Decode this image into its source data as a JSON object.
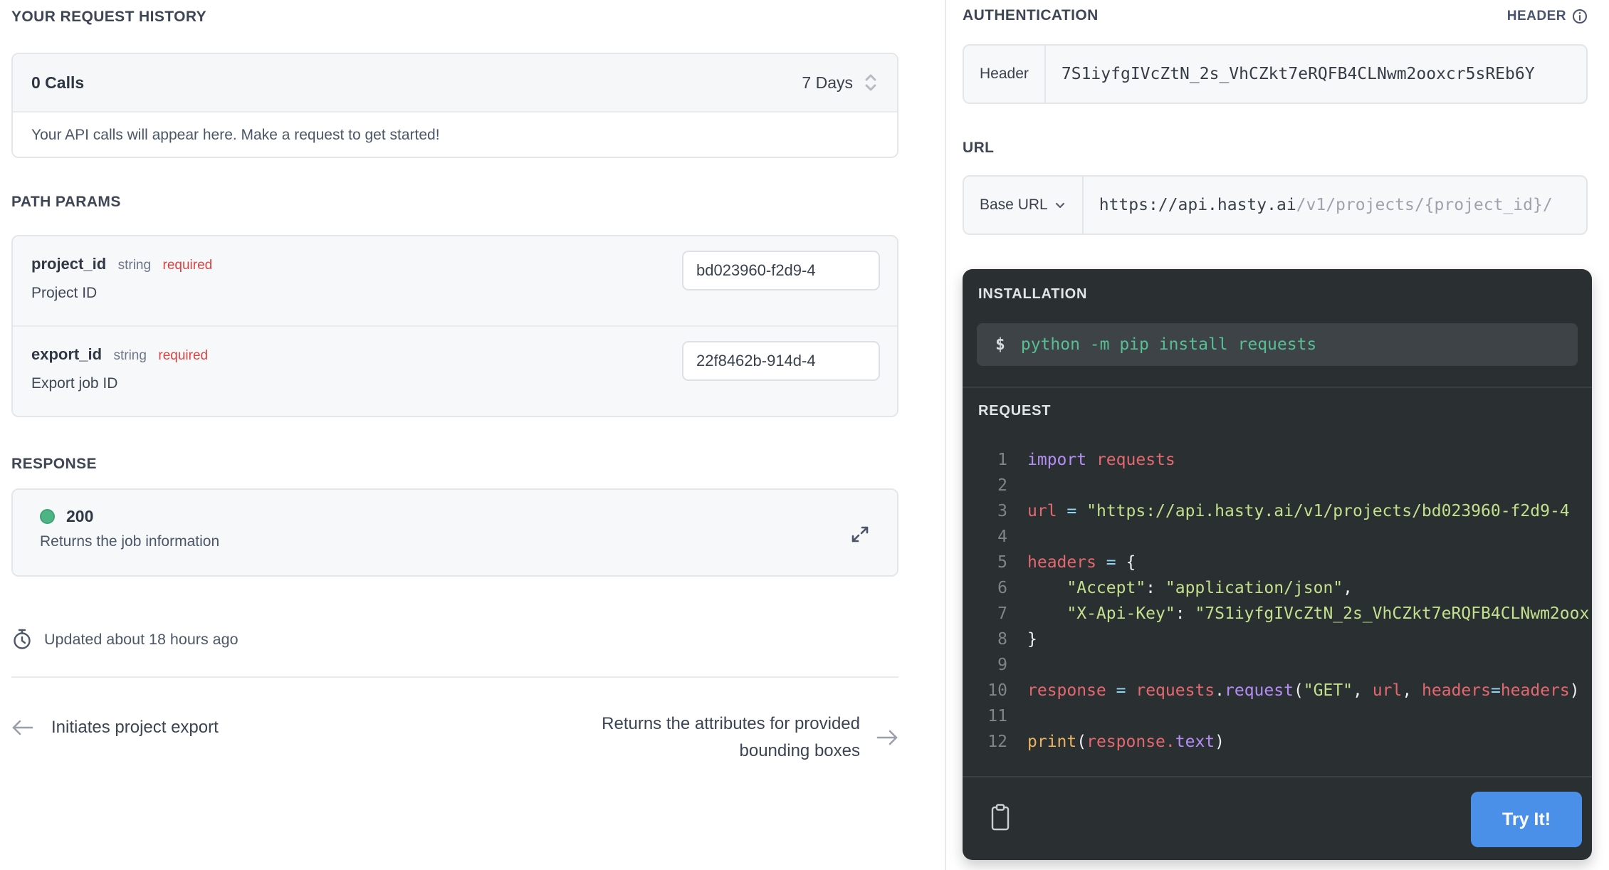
{
  "colors": {
    "accent_blue": "#4a90e8",
    "status_green": "#4db585",
    "required_red": "#db4343",
    "command_green": "#57bf92"
  },
  "request_history": {
    "title": "YOUR REQUEST HISTORY",
    "calls_count": "0 Calls",
    "period": "7 Days",
    "empty_message": "Your API calls will appear here. Make a request to get started!"
  },
  "path_params": {
    "title": "PATH PARAMS",
    "params": [
      {
        "name": "project_id",
        "type": "string",
        "required": "required",
        "description": "Project ID",
        "value": "bd023960-f2d9-4"
      },
      {
        "name": "export_id",
        "type": "string",
        "required": "required",
        "description": "Export job ID",
        "value": "22f8462b-914d-4"
      }
    ]
  },
  "response": {
    "title": "RESPONSE",
    "status_code": "200",
    "description": "Returns the job information"
  },
  "updated_text": "Updated about 18 hours ago",
  "footer_nav": {
    "prev_label": "Initiates project export",
    "next_label": "Returns the attributes for provided bounding boxes"
  },
  "auth": {
    "title": "AUTHENTICATION",
    "type_label": "HEADER",
    "field_label": "Header",
    "value": "7S1iyfgIVcZtN_2s_VhCZkt7eRQFB4CLNwm2ooxcr5sREb6Y"
  },
  "url": {
    "title": "URL",
    "base_label": "Base URL",
    "base": "https://api.hasty.ai",
    "path": "/v1/projects/{project_id}/"
  },
  "code_panel": {
    "installation_title": "INSTALLATION",
    "install_prompt": "$",
    "install_command": "python -m pip install requests",
    "request_title": "REQUEST",
    "try_it_label": "Try It!",
    "request_code": [
      {
        "n": "1",
        "tk": [
          [
            "kw",
            "import"
          ],
          [
            "pl",
            " "
          ],
          [
            "id",
            "requests"
          ]
        ]
      },
      {
        "n": "2",
        "tk": []
      },
      {
        "n": "3",
        "tk": [
          [
            "id",
            "url"
          ],
          [
            "pl",
            " "
          ],
          [
            "op",
            "="
          ],
          [
            "pl",
            " "
          ],
          [
            "str",
            "\"https://api.hasty.ai/v1/projects/bd023960-f2d9-4"
          ]
        ]
      },
      {
        "n": "4",
        "tk": []
      },
      {
        "n": "5",
        "tk": [
          [
            "id",
            "headers"
          ],
          [
            "pl",
            " "
          ],
          [
            "op",
            "="
          ],
          [
            "pl",
            " "
          ],
          [
            "pu",
            "{"
          ]
        ]
      },
      {
        "n": "6",
        "tk": [
          [
            "pl",
            "    "
          ],
          [
            "str",
            "\"Accept\""
          ],
          [
            "pu",
            ":"
          ],
          [
            "pl",
            " "
          ],
          [
            "str",
            "\"application/json\""
          ],
          [
            "pu",
            ","
          ]
        ]
      },
      {
        "n": "7",
        "tk": [
          [
            "pl",
            "    "
          ],
          [
            "str",
            "\"X-Api-Key\""
          ],
          [
            "pu",
            ":"
          ],
          [
            "pl",
            " "
          ],
          [
            "str",
            "\"7S1iyfgIVcZtN_2s_VhCZkt7eRQFB4CLNwm2oox"
          ]
        ]
      },
      {
        "n": "8",
        "tk": [
          [
            "pu",
            "}"
          ]
        ]
      },
      {
        "n": "9",
        "tk": []
      },
      {
        "n": "10",
        "tk": [
          [
            "id",
            "response"
          ],
          [
            "pl",
            " "
          ],
          [
            "op",
            "="
          ],
          [
            "pl",
            " "
          ],
          [
            "id",
            "requests"
          ],
          [
            "pu",
            "."
          ],
          [
            "fn",
            "request"
          ],
          [
            "pu",
            "("
          ],
          [
            "str",
            "\"GET\""
          ],
          [
            "pu",
            ","
          ],
          [
            "pl",
            " "
          ],
          [
            "id",
            "url"
          ],
          [
            "pu",
            ","
          ],
          [
            "pl",
            " "
          ],
          [
            "id",
            "headers"
          ],
          [
            "op",
            "="
          ],
          [
            "id",
            "headers"
          ],
          [
            "pu",
            ")"
          ]
        ]
      },
      {
        "n": "11",
        "tk": []
      },
      {
        "n": "12",
        "tk": [
          [
            "bi",
            "print"
          ],
          [
            "pu",
            "("
          ],
          [
            "id",
            "response"
          ],
          [
            "id",
            "."
          ],
          [
            "fn",
            "text"
          ],
          [
            "pu",
            ")"
          ]
        ]
      }
    ]
  }
}
